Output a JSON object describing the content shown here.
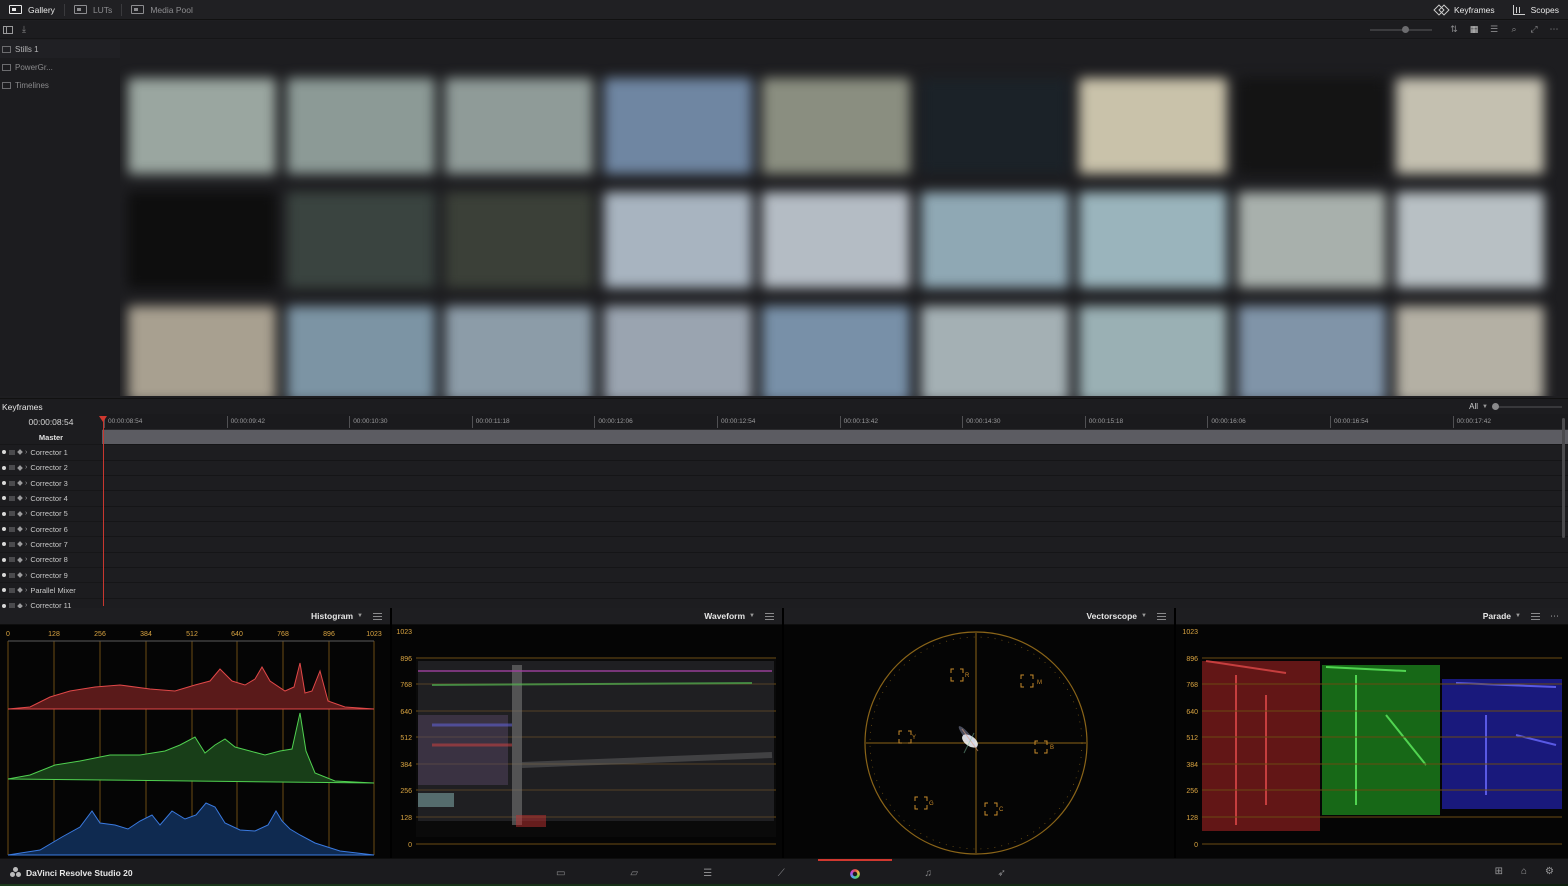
{
  "top_tabs": [
    {
      "label": "Gallery",
      "icon": "gallery-icon",
      "active": true
    },
    {
      "label": "LUTs",
      "icon": "luts-icon",
      "active": false
    },
    {
      "label": "Media Pool",
      "icon": "media-pool-icon",
      "active": false
    }
  ],
  "top_right": {
    "keyframes_label": "Keyframes",
    "scopes_label": "Scopes"
  },
  "albums": [
    {
      "label": "Stills 1",
      "icon": "album-icon"
    },
    {
      "label": "PowerGr...",
      "icon": "powergrade-icon"
    },
    {
      "label": "Timelines",
      "icon": "timelines-icon"
    }
  ],
  "stills_colors": [
    [
      "#9aa6a0",
      "#8c9a96",
      "#8f9b98",
      "#6f86a2",
      "#8a8e80",
      "#1b2228",
      "#c9c2aa",
      "#141414",
      "#c4c0b0"
    ],
    [
      "#0e0e0e",
      "#3a4440",
      "#3b4038",
      "#a8b4c0",
      "#b4bcc4",
      "#8fa8b4",
      "#9ab4bc",
      "#a8b0ac",
      "#b8c0c4"
    ],
    [
      "#a8a090",
      "#7c94a4",
      "#8c9ca8",
      "#9aa4b0",
      "#7890a8",
      "#a4b0b4",
      "#9ab0b4",
      "#8094a8",
      "#b4b0a4"
    ]
  ],
  "keyframes": {
    "title": "Keyframes",
    "filter": "All",
    "current_timecode": "00:00:08:54",
    "ruler_labels": [
      "00:00:08:54",
      "00:00:09:42",
      "00:00:10:30",
      "00:00:11:18",
      "00:00:12:06",
      "00:00:12:54",
      "00:00:13:42",
      "00:00:14:30",
      "00:00:15:18",
      "00:00:16:06",
      "00:00:16:54",
      "00:00:17:42"
    ],
    "master_label": "Master",
    "tracks": [
      "Corrector 1",
      "Corrector 2",
      "Corrector 3",
      "Corrector 4",
      "Corrector 5",
      "Corrector 6",
      "Corrector 7",
      "Corrector 8",
      "Corrector 9",
      "Parallel Mixer",
      "Corrector 11"
    ]
  },
  "scopes": {
    "histogram": {
      "label": "Histogram",
      "axis": [
        "0",
        "128",
        "256",
        "384",
        "512",
        "640",
        "768",
        "896",
        "1023"
      ]
    },
    "waveform": {
      "label": "Waveform",
      "axis": [
        "1023",
        "896",
        "768",
        "640",
        "512",
        "384",
        "256",
        "128",
        "0"
      ]
    },
    "vectorscope": {
      "label": "Vectorscope",
      "targets": [
        "R",
        "M",
        "B",
        "C",
        "G",
        "Y"
      ]
    },
    "parade": {
      "label": "Parade",
      "axis": [
        "1023",
        "896",
        "768",
        "640",
        "512",
        "384",
        "256",
        "128",
        "0"
      ]
    }
  },
  "app_name": "DaVinci Resolve Studio 20",
  "page_tabs": [
    {
      "name": "media-page-tab",
      "glyph": "▭"
    },
    {
      "name": "cut-page-tab",
      "glyph": "▱"
    },
    {
      "name": "edit-page-tab",
      "glyph": "☰"
    },
    {
      "name": "fusion-page-tab",
      "glyph": "⟋"
    },
    {
      "name": "color-page-tab",
      "glyph": ""
    },
    {
      "name": "fairlight-page-tab",
      "glyph": "♫"
    },
    {
      "name": "deliver-page-tab",
      "glyph": "➶"
    }
  ]
}
